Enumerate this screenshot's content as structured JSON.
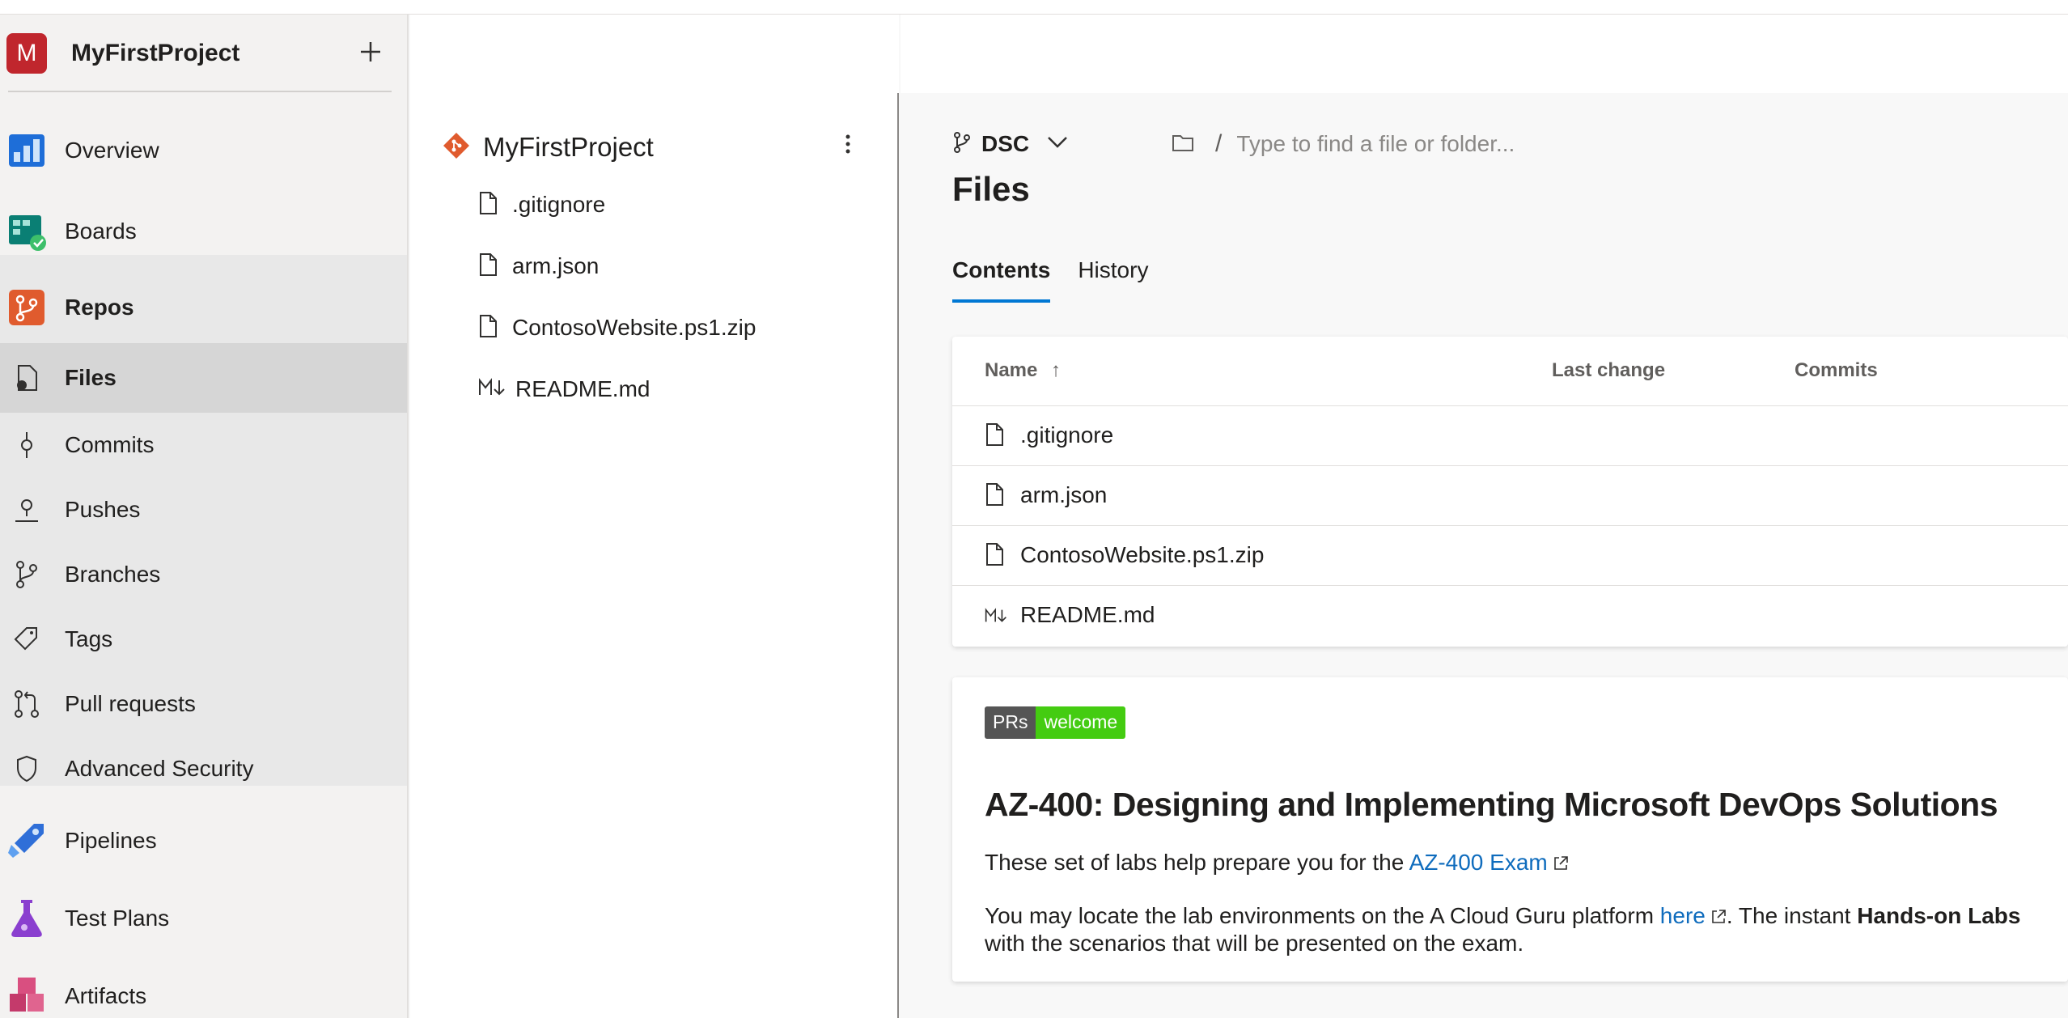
{
  "project": {
    "initial": "M",
    "name": "MyFirstProject",
    "avatar_color": "#c0262d"
  },
  "nav": {
    "overview": "Overview",
    "boards": "Boards",
    "repos": "Repos",
    "files": "Files",
    "commits": "Commits",
    "pushes": "Pushes",
    "branches": "Branches",
    "tags": "Tags",
    "pull_requests": "Pull requests",
    "advanced_security": "Advanced Security",
    "pipelines": "Pipelines",
    "test_plans": "Test Plans",
    "artifacts": "Artifacts"
  },
  "tree": {
    "repo_name": "MyFirstProject",
    "items": [
      ".gitignore",
      "arm.json",
      "ContosoWebsite.ps1.zip",
      "README.md"
    ]
  },
  "toolbar": {
    "branch": "DSC",
    "path_separator": "/",
    "path_placeholder": "Type to find a file or folder..."
  },
  "page": {
    "title": "Files"
  },
  "tabs": [
    {
      "label": "Contents",
      "active": true
    },
    {
      "label": "History",
      "active": false
    }
  ],
  "table": {
    "headers": {
      "name": "Name",
      "sort_arrow": "↑",
      "last_change": "Last change",
      "commits": "Commits"
    },
    "rows": [
      {
        "name": ".gitignore",
        "icon": "file-icon"
      },
      {
        "name": "arm.json",
        "icon": "file-icon"
      },
      {
        "name": "ContosoWebsite.ps1.zip",
        "icon": "file-icon"
      },
      {
        "name": "README.md",
        "icon": "markdown-icon"
      }
    ]
  },
  "readme": {
    "badge_left": "PRs",
    "badge_right": "welcome",
    "heading": "AZ-400: Designing and Implementing Microsoft DevOps Solutions",
    "p1_text": "These set of labs help prepare you for the ",
    "p1_link": "AZ-400 Exam",
    "p2_text1": "You may locate the lab environments on the A Cloud Guru platform ",
    "p2_link": "here",
    "p2_text2": ". The instant ",
    "p2_bold": "Hands-on Labs",
    "p3_text": "with the scenarios that will be presented on the exam."
  },
  "colors": {
    "accent": "#0078d4",
    "link": "#0f6cbd",
    "badge_green": "#44cc11",
    "badge_gray": "#555555"
  }
}
